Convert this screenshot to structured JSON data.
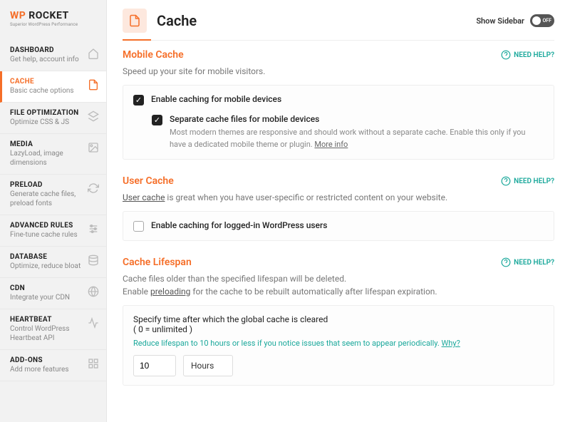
{
  "brand": {
    "wp": "WP",
    "rocket": " ROCKET",
    "tagline": "Superior WordPress Performance"
  },
  "nav": {
    "items": [
      {
        "title": "Dashboard",
        "desc": "Get help, account info",
        "icon": "home"
      },
      {
        "title": "Cache",
        "desc": "Basic cache options",
        "icon": "file"
      },
      {
        "title": "File Optimization",
        "desc": "Optimize CSS & JS",
        "icon": "layers"
      },
      {
        "title": "Media",
        "desc": "LazyLoad, image dimensions",
        "icon": "image"
      },
      {
        "title": "Preload",
        "desc": "Generate cache files, preload fonts",
        "icon": "refresh"
      },
      {
        "title": "Advanced Rules",
        "desc": "Fine-tune cache rules",
        "icon": "sliders"
      },
      {
        "title": "Database",
        "desc": "Optimize, reduce bloat",
        "icon": "database"
      },
      {
        "title": "CDN",
        "desc": "Integrate your CDN",
        "icon": "globe"
      },
      {
        "title": "Heartbeat",
        "desc": "Control WordPress Heartbeat API",
        "icon": "heart"
      },
      {
        "title": "Add-ons",
        "desc": "Add more features",
        "icon": "puzzle"
      }
    ]
  },
  "page": {
    "title": "Cache",
    "show_sidebar_label": "Show Sidebar",
    "switch_off": "OFF"
  },
  "need_help": "NEED HELP?",
  "mobile": {
    "title": "Mobile Cache",
    "desc": "Speed up your site for mobile visitors.",
    "opt1": "Enable caching for mobile devices",
    "opt2": "Separate cache files for mobile devices",
    "opt2_desc": "Most modern themes are responsive and should work without a separate cache. Enable this only if you have a dedicated mobile theme or plugin. ",
    "more_info": "More info"
  },
  "user": {
    "title": "User Cache",
    "link": "User cache",
    "desc_rest": " is great when you have user-specific or restricted content on your website.",
    "opt1": "Enable caching for logged-in WordPress users"
  },
  "lifespan": {
    "title": "Cache Lifespan",
    "desc1": "Cache files older than the specified lifespan will be deleted.",
    "desc2a": "Enable ",
    "preloading": "preloading",
    "desc2b": " for the cache to be rebuilt automatically after lifespan expiration.",
    "box_title": "Specify time after which the global cache is cleared",
    "box_sub": "( 0 = unlimited )",
    "hint": "Reduce lifespan to 10 hours or less if you notice issues that seem to appear periodically. ",
    "why": "Why?",
    "value": "10",
    "unit": "Hours"
  }
}
